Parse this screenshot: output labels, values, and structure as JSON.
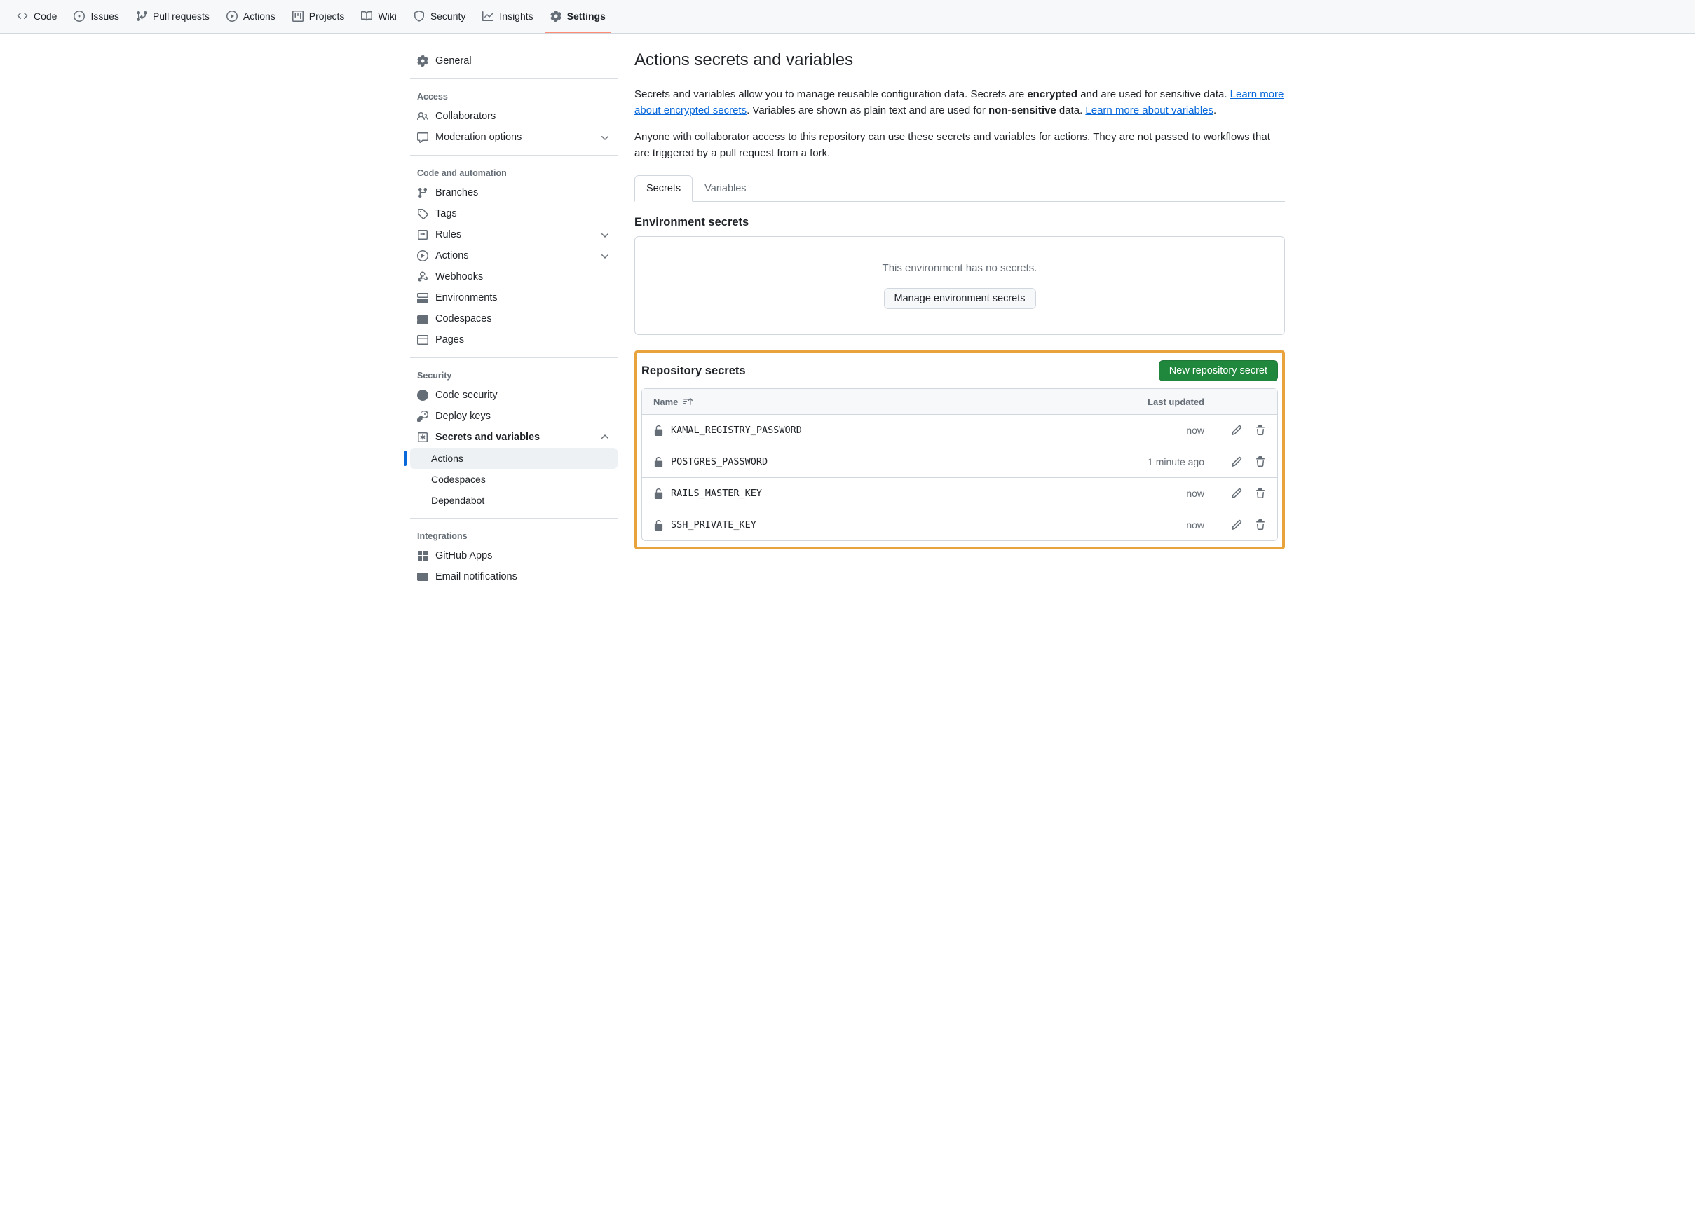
{
  "repoNav": [
    {
      "label": "Code",
      "icon": "code"
    },
    {
      "label": "Issues",
      "icon": "issue"
    },
    {
      "label": "Pull requests",
      "icon": "pr"
    },
    {
      "label": "Actions",
      "icon": "play"
    },
    {
      "label": "Projects",
      "icon": "project"
    },
    {
      "label": "Wiki",
      "icon": "book"
    },
    {
      "label": "Security",
      "icon": "shield"
    },
    {
      "label": "Insights",
      "icon": "graph"
    },
    {
      "label": "Settings",
      "icon": "gear",
      "active": true
    }
  ],
  "sidebar": {
    "general": "General",
    "groups": [
      {
        "heading": "Access",
        "items": [
          {
            "label": "Collaborators",
            "icon": "people"
          },
          {
            "label": "Moderation options",
            "icon": "comment",
            "expandable": true
          }
        ]
      },
      {
        "heading": "Code and automation",
        "items": [
          {
            "label": "Branches",
            "icon": "branch"
          },
          {
            "label": "Tags",
            "icon": "tag"
          },
          {
            "label": "Rules",
            "icon": "rules",
            "expandable": true
          },
          {
            "label": "Actions",
            "icon": "play",
            "expandable": true
          },
          {
            "label": "Webhooks",
            "icon": "webhook"
          },
          {
            "label": "Environments",
            "icon": "server"
          },
          {
            "label": "Codespaces",
            "icon": "codespaces"
          },
          {
            "label": "Pages",
            "icon": "browser"
          }
        ]
      },
      {
        "heading": "Security",
        "items": [
          {
            "label": "Code security",
            "icon": "codesec"
          },
          {
            "label": "Deploy keys",
            "icon": "key"
          },
          {
            "label": "Secrets and variables",
            "icon": "asterisk",
            "expandable": true,
            "expanded": true,
            "bold": true,
            "subitems": [
              {
                "label": "Actions",
                "active": true
              },
              {
                "label": "Codespaces"
              },
              {
                "label": "Dependabot"
              }
            ]
          }
        ]
      },
      {
        "heading": "Integrations",
        "items": [
          {
            "label": "GitHub Apps",
            "icon": "apps"
          },
          {
            "label": "Email notifications",
            "icon": "mail"
          }
        ]
      }
    ]
  },
  "main": {
    "title": "Actions secrets and variables",
    "descParts": {
      "p1a": "Secrets and variables allow you to manage reusable configuration data. Secrets are ",
      "p1b_strong": "encrypted",
      "p1c": " and are used for sensitive data. ",
      "p1link1": "Learn more about encrypted secrets",
      "p1d": ". Variables are shown as plain text and are used for ",
      "p1e_strong": "non-sensitive",
      "p1f": " data. ",
      "p1link2": "Learn more about variables",
      "p1g": ".",
      "p2": "Anyone with collaborator access to this repository can use these secrets and variables for actions. They are not passed to workflows that are triggered by a pull request from a fork."
    },
    "tabs": {
      "secrets": "Secrets",
      "variables": "Variables"
    },
    "envSecrets": {
      "title": "Environment secrets",
      "empty": "This environment has no secrets.",
      "button": "Manage environment secrets"
    },
    "repoSecrets": {
      "title": "Repository secrets",
      "newBtn": "New repository secret",
      "colName": "Name",
      "colUpdated": "Last updated",
      "rows": [
        {
          "name": "KAMAL_REGISTRY_PASSWORD",
          "updated": "now"
        },
        {
          "name": "POSTGRES_PASSWORD",
          "updated": "1 minute ago"
        },
        {
          "name": "RAILS_MASTER_KEY",
          "updated": "now"
        },
        {
          "name": "SSH_PRIVATE_KEY",
          "updated": "now"
        }
      ]
    }
  }
}
